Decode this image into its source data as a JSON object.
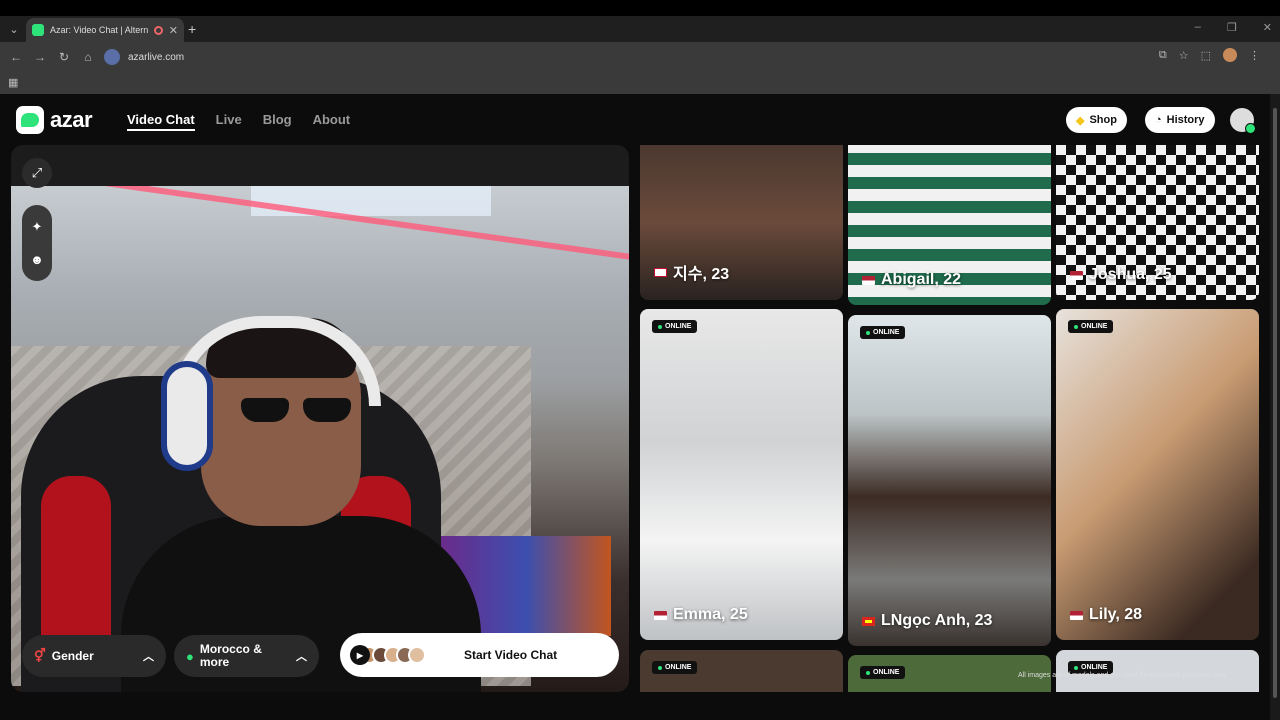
{
  "browser": {
    "tab_title": "Azar: Video Chat | Alternati",
    "url": "azarlive.com",
    "window_controls": [
      "–",
      "❐",
      "✕"
    ]
  },
  "header": {
    "logo_text": "azar",
    "nav": [
      {
        "label": "Video Chat",
        "active": true
      },
      {
        "label": "Live",
        "active": false
      },
      {
        "label": "Blog",
        "active": false
      },
      {
        "label": "About",
        "active": false
      }
    ],
    "shop_label": "Shop",
    "history_label": "History"
  },
  "video_panel": {
    "gender_label": "Gender",
    "region_label": "Morocco & more",
    "start_label": "Start Video Chat"
  },
  "gallery": {
    "online_label": "ONLINE",
    "cards": [
      {
        "name": "지수, 23",
        "flag_colors": [
          "#ffffff",
          "#c60c30"
        ]
      },
      {
        "name": "Abigail, 22",
        "flag_colors": [
          "#b22234",
          "#ffffff"
        ]
      },
      {
        "name": "Joshua, 25",
        "flag_colors": [
          "#b22234",
          "#ffffff"
        ]
      },
      {
        "name": "Emma, 25",
        "flag_colors": [
          "#b22234",
          "#ffffff"
        ]
      },
      {
        "name": "LNgọc Anh, 23",
        "flag_colors": [
          "#da251d",
          "#ffff00"
        ]
      },
      {
        "name": "Lily, 28",
        "flag_colors": [
          "#b22234",
          "#ffffff"
        ]
      }
    ],
    "disclaimer": "All images are of models and are used for illustrative purposes only."
  },
  "colors": {
    "accent": "#2ee37a",
    "background": "#0c0c0c"
  }
}
